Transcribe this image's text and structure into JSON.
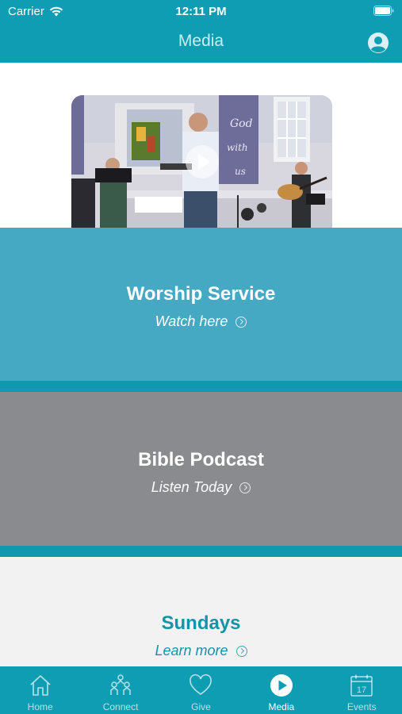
{
  "status": {
    "carrier": "Carrier",
    "time": "12:11 PM"
  },
  "nav": {
    "title": "Media"
  },
  "video": {
    "play_icon": "play-icon"
  },
  "sections": {
    "worship": {
      "title": "Worship Service",
      "link": "Watch here"
    },
    "podcast": {
      "title": "Bible Podcast",
      "link": "Listen Today"
    },
    "sundays": {
      "title": "Sundays",
      "link": "Learn more"
    }
  },
  "tabs": [
    {
      "label": "Home",
      "icon": "home-icon"
    },
    {
      "label": "Connect",
      "icon": "people-icon"
    },
    {
      "label": "Give",
      "icon": "heart-icon"
    },
    {
      "label": "Media",
      "icon": "play-circle-icon",
      "active": true
    },
    {
      "label": "Events",
      "icon": "calendar-icon",
      "badge": "17"
    }
  ],
  "colors": {
    "primary": "#0e9db3",
    "worship_bg": "#46a9c3",
    "podcast_bg": "#8a8b8e",
    "sundays_bg": "#f2f2f3",
    "sundays_text": "#1494a8"
  }
}
